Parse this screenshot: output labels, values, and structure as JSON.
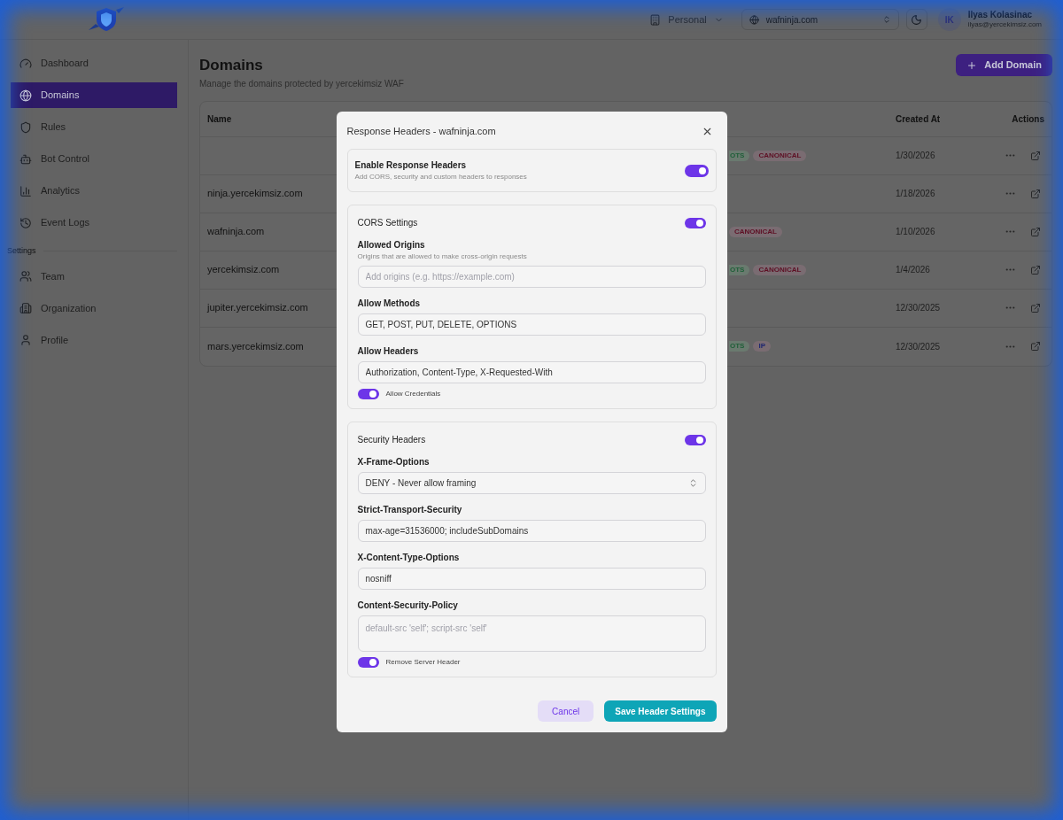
{
  "header": {
    "workspace": "Personal",
    "domain_select": "wafninja.com",
    "user": {
      "initials": "IK",
      "name": "Ilyas Kolasinac",
      "email": "ilyas@yercekimsiz.com"
    }
  },
  "sidebar": {
    "items": [
      {
        "label": "Dashboard",
        "selected": false
      },
      {
        "label": "Domains",
        "selected": true
      },
      {
        "label": "Rules",
        "selected": false
      },
      {
        "label": "Bot Control",
        "selected": false
      },
      {
        "label": "Analytics",
        "selected": false
      },
      {
        "label": "Event Logs",
        "selected": false
      }
    ],
    "section_label": "Settings",
    "settings_items": [
      {
        "label": "Team",
        "selected": false
      },
      {
        "label": "Organization",
        "selected": false
      },
      {
        "label": "Profile",
        "selected": false
      }
    ]
  },
  "page": {
    "title": "Domains",
    "subtitle": "Manage the domains protected by yercekimsiz WAF",
    "add_button": "Add Domain"
  },
  "table": {
    "columns": [
      "Name",
      "Created At",
      "Actions"
    ],
    "rows": [
      {
        "badges": [
          {
            "label": "OTS",
            "color": "#1f5f38",
            "cut": true
          },
          {
            "label": "CANONICAL",
            "color": "#5e0f24",
            "cut": false
          }
        ],
        "created_at": "1/30/2026"
      },
      {
        "name": "ninja.yercekimsiz.com",
        "badges": [],
        "created_at": "1/18/2026"
      },
      {
        "name": "wafninja.com",
        "badges": [
          {
            "label": "CANONICAL",
            "color": "#5e0f24",
            "cut": false
          }
        ],
        "created_at": "1/10/2026"
      },
      {
        "name": "yercekimsiz.com",
        "badges": [
          {
            "label": "OTS",
            "color": "#1f5f38",
            "cut": true
          },
          {
            "label": "CANONICAL",
            "color": "#5e0f24",
            "cut": false
          }
        ],
        "created_at": "1/4/2026"
      },
      {
        "name": "jupiter.yercekimsiz.com",
        "badges": [],
        "created_at": "12/30/2025"
      },
      {
        "name": "mars.yercekimsiz.com",
        "badges": [
          {
            "label": "OTS",
            "color": "#1f5f38",
            "cut": true
          },
          {
            "label": "IP",
            "color": "#1e2670",
            "cut": false
          }
        ],
        "created_at": "12/30/2025"
      }
    ]
  },
  "dialog": {
    "title": "Response Headers - wafninja.com",
    "master": {
      "label": "Enable Response Headers",
      "description": "Add CORS, security and custom headers to responses",
      "on": true
    },
    "sections": [
      {
        "title": "CORS Settings",
        "on": true,
        "fields": [
          {
            "kind": "input",
            "label": "Allowed Origins",
            "hint": "Origins that are allowed to make cross-origin requests",
            "placeholder": "Add origins (e.g. https://example.com)"
          },
          {
            "kind": "input",
            "label": "Allow Methods",
            "value": "GET, POST, PUT, DELETE, OPTIONS"
          },
          {
            "kind": "input",
            "label": "Allow Headers",
            "value": "Authorization, Content-Type, X-Requested-With"
          }
        ],
        "switch": {
          "label": "Allow Credentials",
          "on": true
        }
      },
      {
        "title": "Security Headers",
        "on": true,
        "fields": [
          {
            "kind": "select",
            "label": "X-Frame-Options",
            "value": "DENY - Never allow framing"
          },
          {
            "kind": "input",
            "label": "Strict-Transport-Security",
            "value": "max-age=31536000; includeSubDomains"
          },
          {
            "kind": "input",
            "label": "X-Content-Type-Options",
            "value": "nosniff"
          },
          {
            "kind": "textarea",
            "label": "Content-Security-Policy",
            "placeholder": "default-src 'self'; script-src 'self'"
          }
        ],
        "switch": {
          "label": "Remove Server Header",
          "on": true
        }
      }
    ],
    "buttons": {
      "cancel": "Cancel",
      "save": "Save Header Settings"
    }
  }
}
